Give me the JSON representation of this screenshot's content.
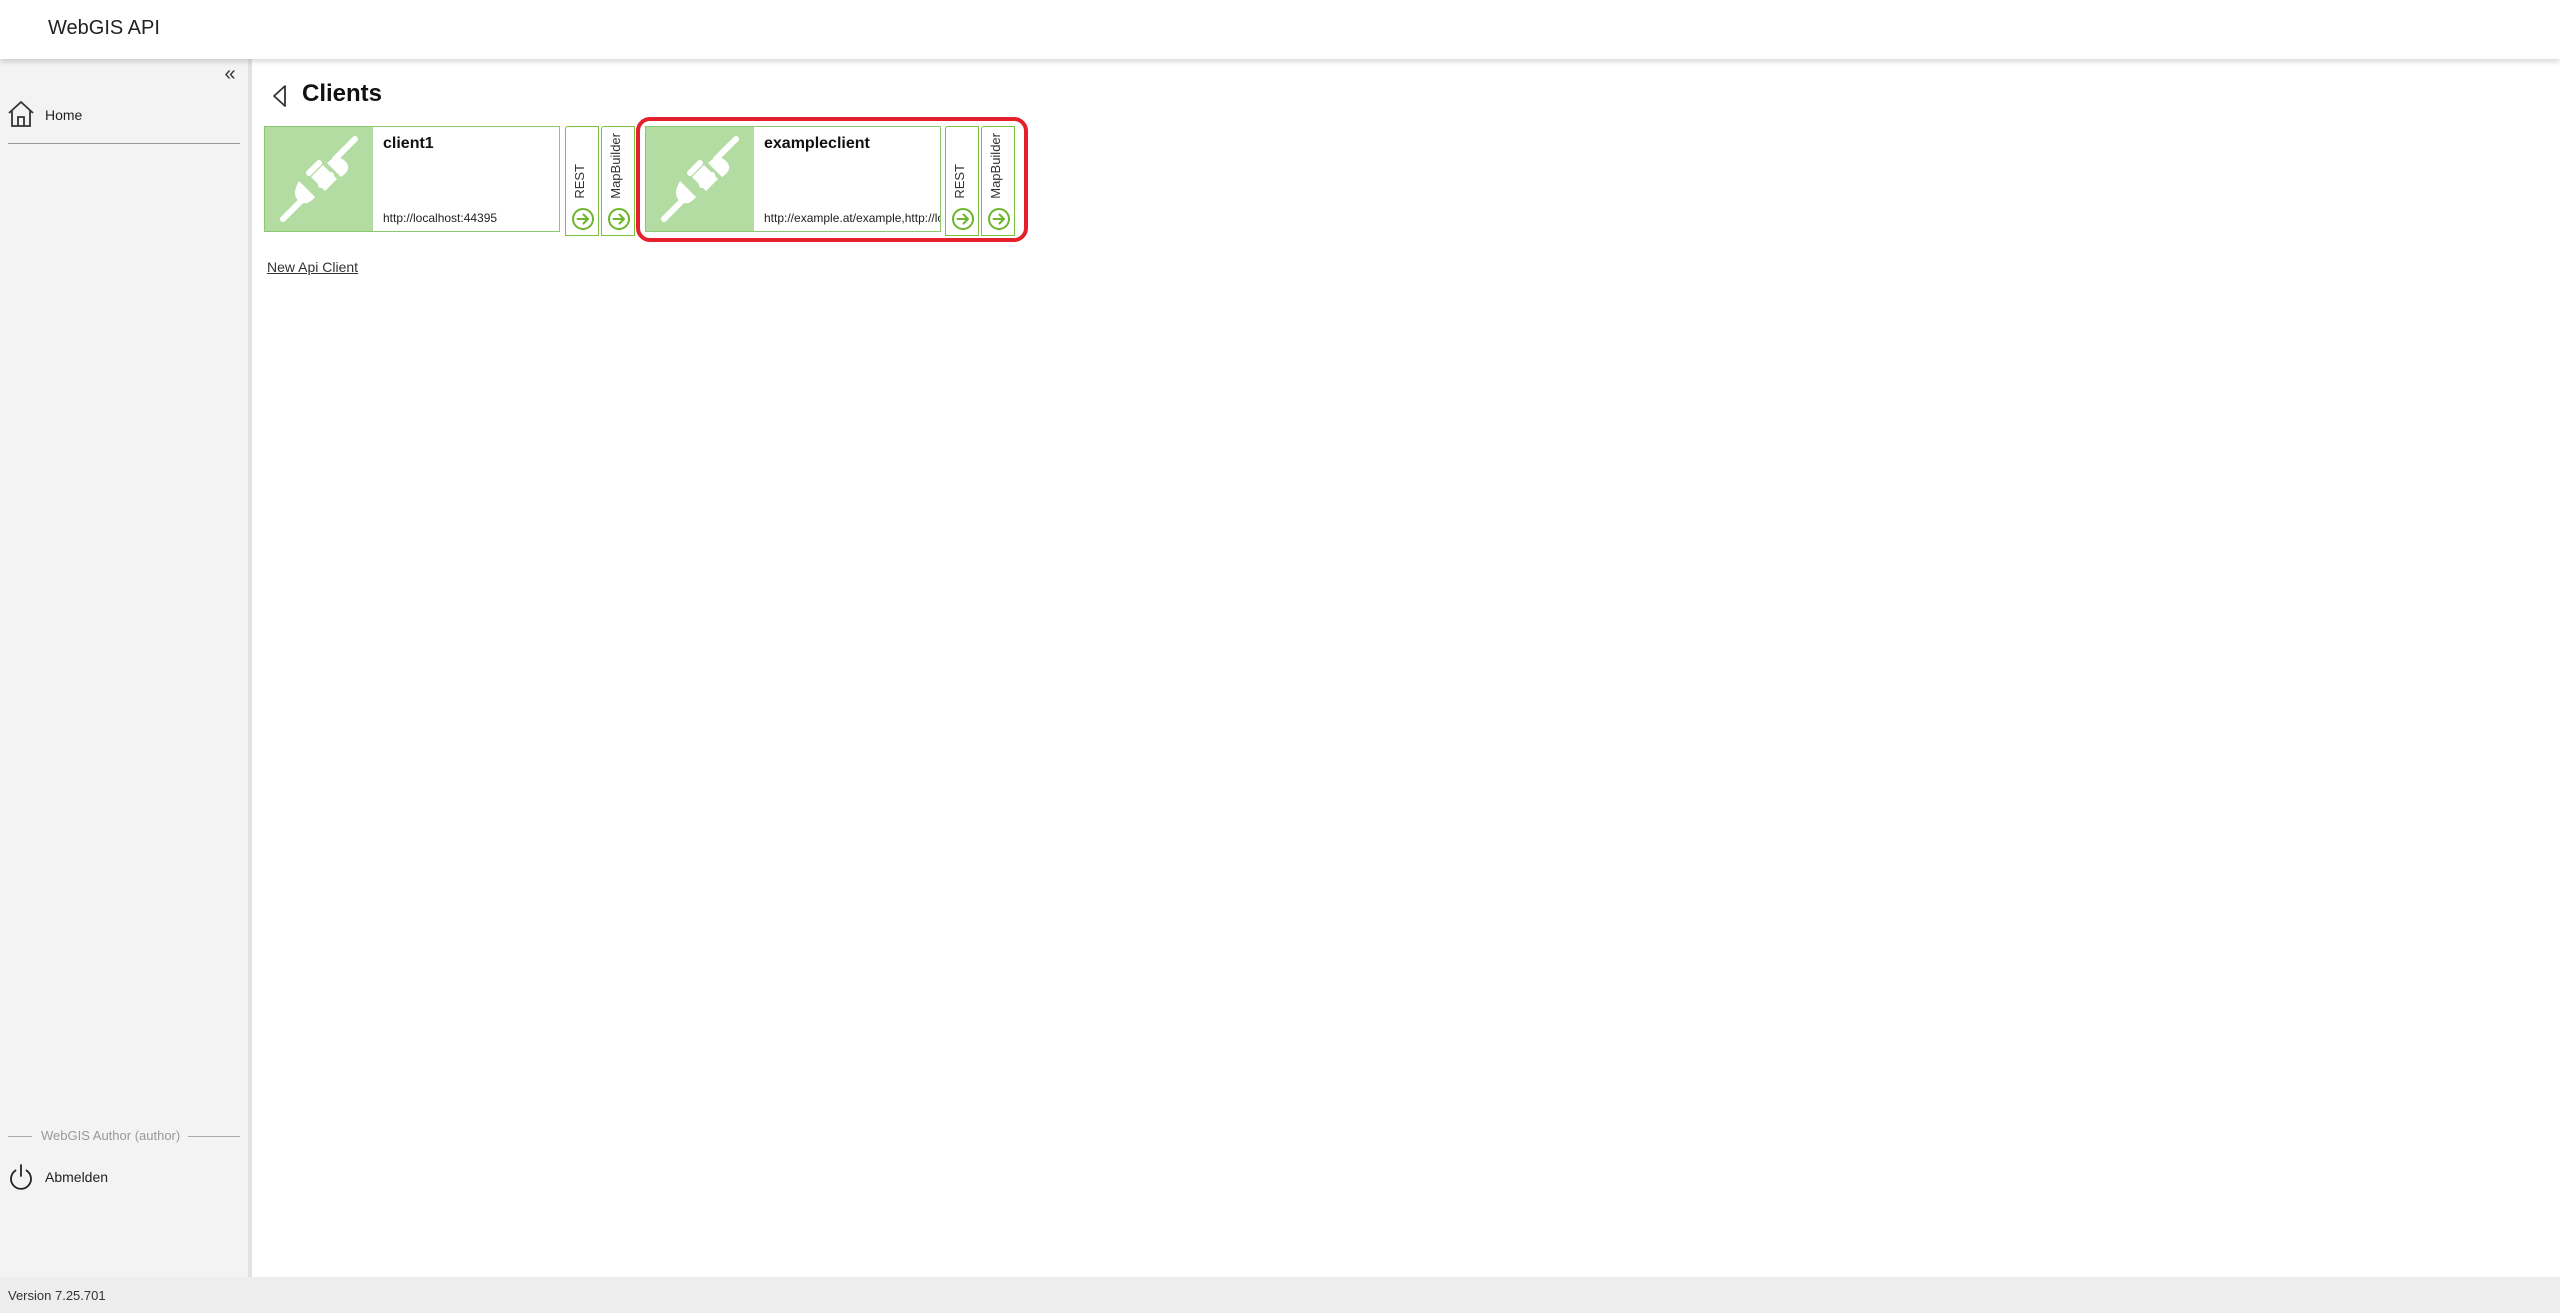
{
  "app": {
    "title": "WebGIS API"
  },
  "sidebar": {
    "collapse_glyph": "«",
    "home_label": "Home",
    "user_label": "WebGIS Author (author)",
    "logout_label": "Abmelden"
  },
  "page": {
    "title": "Clients"
  },
  "clients": [
    {
      "name": "client1",
      "url": "http://localhost:44395",
      "rest_label": "REST",
      "mapbuilder_label": "MapBuilder"
    },
    {
      "name": "exampleclient",
      "url": "http://example.at/example,http://localhost",
      "rest_label": "REST",
      "mapbuilder_label": "MapBuilder"
    }
  ],
  "new_client_link": "New Api Client",
  "footer": {
    "version": "Version 7.25.701"
  },
  "colors": {
    "accent_green": "#7cc03e",
    "thumb_green": "#b2dca2",
    "highlight_red": "#e3202b"
  },
  "icons": [
    "chevron-double-left-icon",
    "home-icon",
    "power-icon",
    "back-triangle-icon",
    "plug-disconnected-icon",
    "arrow-right-circle-icon"
  ]
}
